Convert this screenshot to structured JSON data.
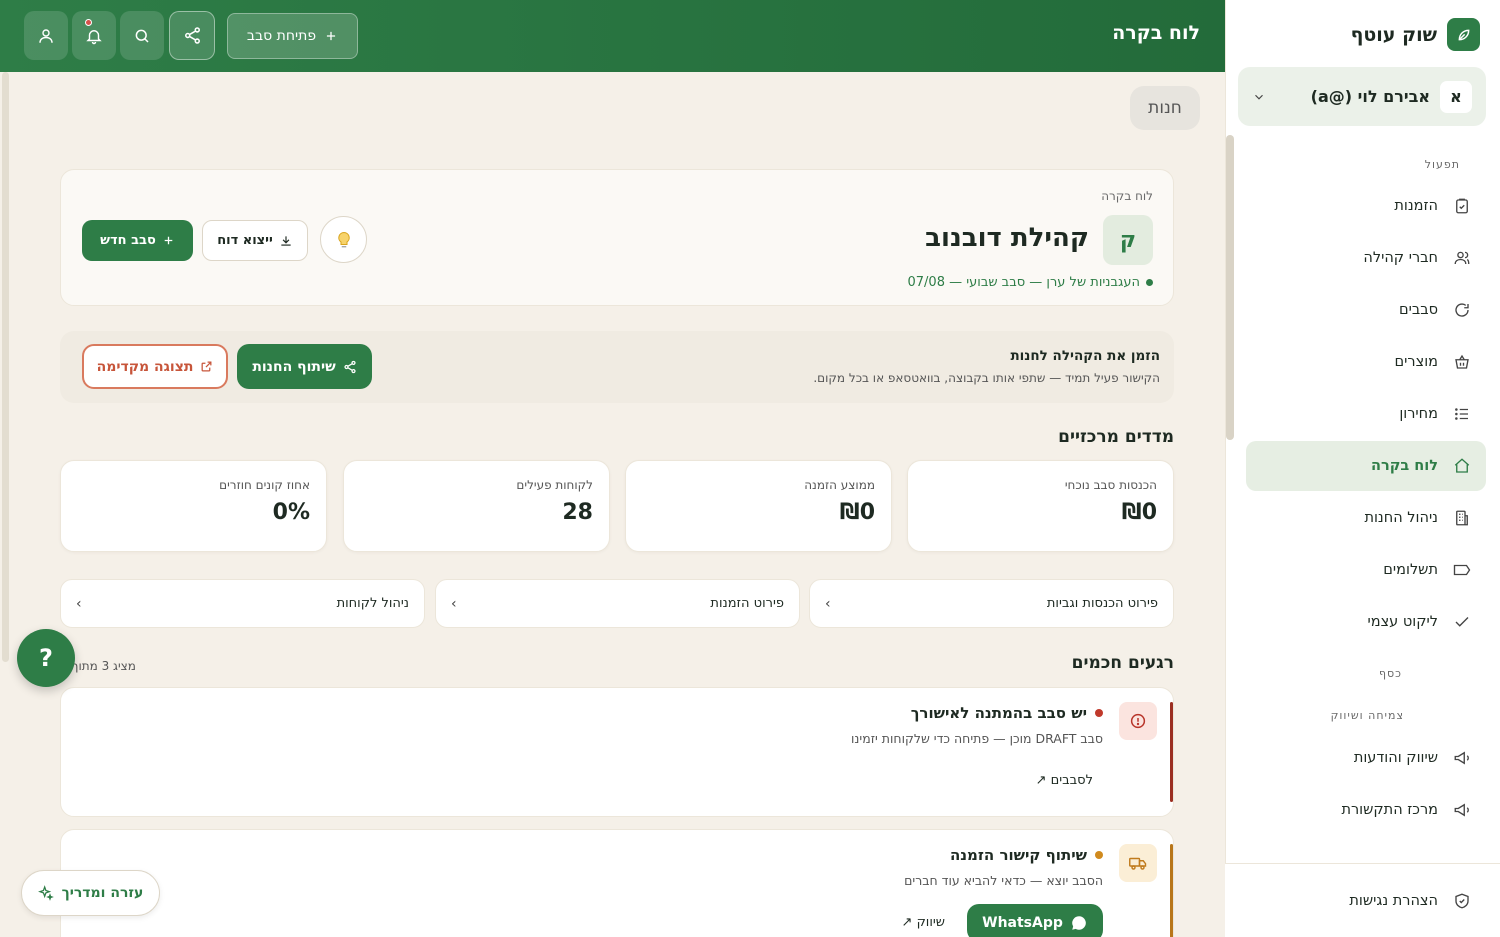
{
  "sidebar": {
    "brand_name": "שוק עוטף",
    "user_initial": "א",
    "user_name": "אבירם לוי (@a)",
    "section_operation": "תפעול",
    "section_money": "כסף",
    "section_growth": "צמיחה ושיווק",
    "items": [
      {
        "label": "הזמנות",
        "icon": "clipboard-check-icon"
      },
      {
        "label": "חברי קהילה",
        "icon": "users-icon"
      },
      {
        "label": "סבבים",
        "icon": "refresh-icon"
      },
      {
        "label": "מוצרים",
        "icon": "basket-icon"
      },
      {
        "label": "מחירון",
        "icon": "list-icon"
      },
      {
        "label": "לוח בקרה",
        "icon": "home-icon"
      },
      {
        "label": "ניהול החנות",
        "icon": "building-icon"
      },
      {
        "label": "תשלומים",
        "icon": "tag-icon"
      },
      {
        "label": "ליקוט עצמי",
        "icon": "check-icon"
      },
      {
        "label": "שיווק והודעות",
        "icon": "megaphone-icon"
      },
      {
        "label": "מרכז התקשורת",
        "icon": "megaphone-icon"
      }
    ],
    "footer_item": {
      "label": "הצהרת נגישות",
      "icon": "shield-icon"
    }
  },
  "topbar": {
    "title": "לוח בקרה",
    "open_cycle_label": "פתיחת סבב"
  },
  "store_pill": "חנות",
  "hero": {
    "eyebrow": "לוח בקרה",
    "avatar_initial": "ק",
    "title": "קהילת דובנוב",
    "subtitle": "העגבניות של ערן — סבב שבועי — 07/08",
    "new_cycle_label": "סבב חדש",
    "export_label": "ייצוא דוח"
  },
  "invite": {
    "title": "הזמן את הקהילה לחנות",
    "subtitle": "הקישור פעיל תמיד — שתפי אותו בקבוצה, בוואטסאפ או בכל מקום.",
    "share_label": "שיתוף החנות",
    "preview_label": "תצוגה מקדימה"
  },
  "metrics": {
    "title": "מדדים מרכזיים",
    "cards": [
      {
        "label": "הכנסות סבב נוכחי",
        "value": "₪0"
      },
      {
        "label": "ממוצע הזמנה",
        "value": "₪0"
      },
      {
        "label": "לקוחות פעילים",
        "value": "28"
      },
      {
        "label": "אחוז קונים חוזרים",
        "value": "0%"
      }
    ]
  },
  "links": [
    {
      "label": "פירוט הכנסות וגביות",
      "chevron": "›"
    },
    {
      "label": "פירוט הזמנות",
      "chevron": "›"
    },
    {
      "label": "ניהול לקוחות",
      "chevron": "›"
    }
  ],
  "moments": {
    "title": "רגעים חכמים",
    "count_text": "מציג 3 מתוך",
    "items": [
      {
        "title": "יש סבב בהמתנה לאישורך",
        "description": "סבב DRAFT מוכן — פתיחה כדי שלקוחות יזמינו",
        "link_label": "לסבבים ↗",
        "accent": "#9b2f22",
        "dot": "#c0392b",
        "icon_bg": "#fbe4df",
        "icon": "alert-circle-icon"
      },
      {
        "title": "שיתוף קישור הזמנה",
        "description": "הסבב יוצא — כדאי להביא עוד חברים",
        "link_label": "שיווק ↗",
        "whatsapp_label": "WhatsApp",
        "accent": "#b8761a",
        "dot": "#d08a1e",
        "icon_bg": "#fbeed6",
        "icon": "truck-icon"
      }
    ]
  },
  "floating": {
    "help_fab": "?",
    "help_guide_label": "עזרה ומדריך"
  },
  "colors": {
    "brand": "#2e7d47",
    "background": "#f5f0e8",
    "danger": "#c0392b",
    "warning": "#d08a1e"
  }
}
